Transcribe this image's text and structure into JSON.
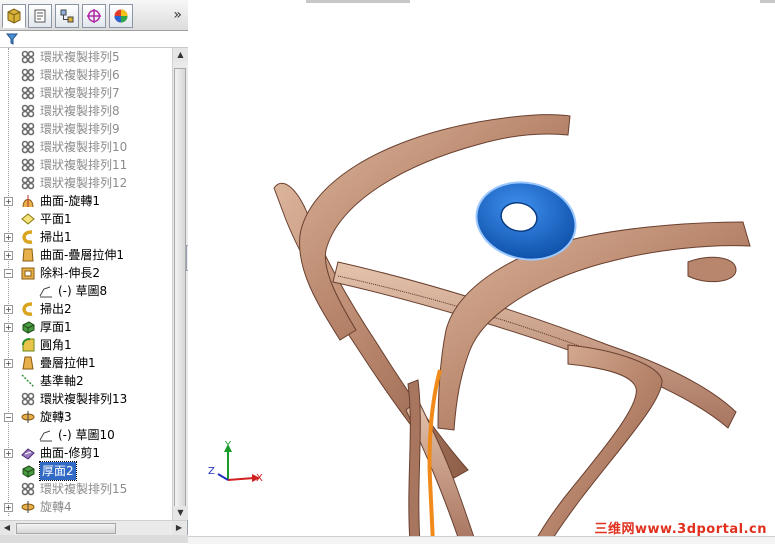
{
  "panel": {
    "more_glyph": "»",
    "tabs": [
      {
        "name": "feature-manager-tab-icon"
      },
      {
        "name": "property-manager-tab-icon"
      },
      {
        "name": "configuration-manager-tab-icon"
      },
      {
        "name": "dimxpert-tab-icon"
      },
      {
        "name": "display-manager-tab-icon"
      }
    ]
  },
  "tree": {
    "items": [
      {
        "label": "環狀複製排列5",
        "icon": "circular-pattern-icon",
        "dim": true
      },
      {
        "label": "環狀複製排列6",
        "icon": "circular-pattern-icon",
        "dim": true
      },
      {
        "label": "環狀複製排列7",
        "icon": "circular-pattern-icon",
        "dim": true
      },
      {
        "label": "環狀複製排列8",
        "icon": "circular-pattern-icon",
        "dim": true
      },
      {
        "label": "環狀複製排列9",
        "icon": "circular-pattern-icon",
        "dim": true
      },
      {
        "label": "環狀複製排列10",
        "icon": "circular-pattern-icon",
        "dim": true
      },
      {
        "label": "環狀複製排列11",
        "icon": "circular-pattern-icon",
        "dim": true
      },
      {
        "label": "環狀複製排列12",
        "icon": "circular-pattern-icon",
        "dim": true
      },
      {
        "label": "曲面-旋轉1",
        "icon": "surface-revolve-icon",
        "expand": "+"
      },
      {
        "label": "平面1",
        "icon": "plane-icon"
      },
      {
        "label": "掃出1",
        "icon": "sweep-icon",
        "expand": "+"
      },
      {
        "label": "曲面-疊層拉伸1",
        "icon": "surface-loft-icon",
        "expand": "+"
      },
      {
        "label": "除料-伸長2",
        "icon": "cut-extrude-icon",
        "expand": "−"
      },
      {
        "label": "(-) 草圖8",
        "icon": "sketch-icon",
        "indent": true
      },
      {
        "label": "掃出2",
        "icon": "sweep-icon",
        "expand": "+"
      },
      {
        "label": "厚面1",
        "icon": "thicken-icon",
        "expand": "+"
      },
      {
        "label": "圓角1",
        "icon": "fillet-icon"
      },
      {
        "label": "疊層拉伸1",
        "icon": "loft-icon",
        "expand": "+"
      },
      {
        "label": "基準軸2",
        "icon": "axis-icon"
      },
      {
        "label": "環狀複製排列13",
        "icon": "circular-pattern-icon"
      },
      {
        "label": "旋轉3",
        "icon": "revolve-icon",
        "expand": "−"
      },
      {
        "label": "(-) 草圖10",
        "icon": "sketch-icon",
        "indent": true
      },
      {
        "label": "曲面-修剪1",
        "icon": "surface-trim-icon",
        "expand": "+"
      },
      {
        "label": "厚面2",
        "icon": "thicken-icon",
        "selected": true
      },
      {
        "label": "環狀複製排列15",
        "icon": "circular-pattern-icon",
        "dim": true
      },
      {
        "label": "旋轉4",
        "icon": "revolve-icon",
        "dim": true,
        "expand": "+"
      }
    ]
  },
  "viewport": {
    "watermark": "三维网www.3dportal.cn",
    "triad": {
      "x": "X",
      "y": "Y",
      "z": "Z"
    }
  },
  "colors": {
    "part_fill": "#c09078",
    "part_dark": "#7a5040",
    "part_light": "#e3c0a8",
    "selected_face": "#1d6fd6",
    "highlight_edge": "#f08a1a",
    "tree_selection": "#316ac5"
  }
}
